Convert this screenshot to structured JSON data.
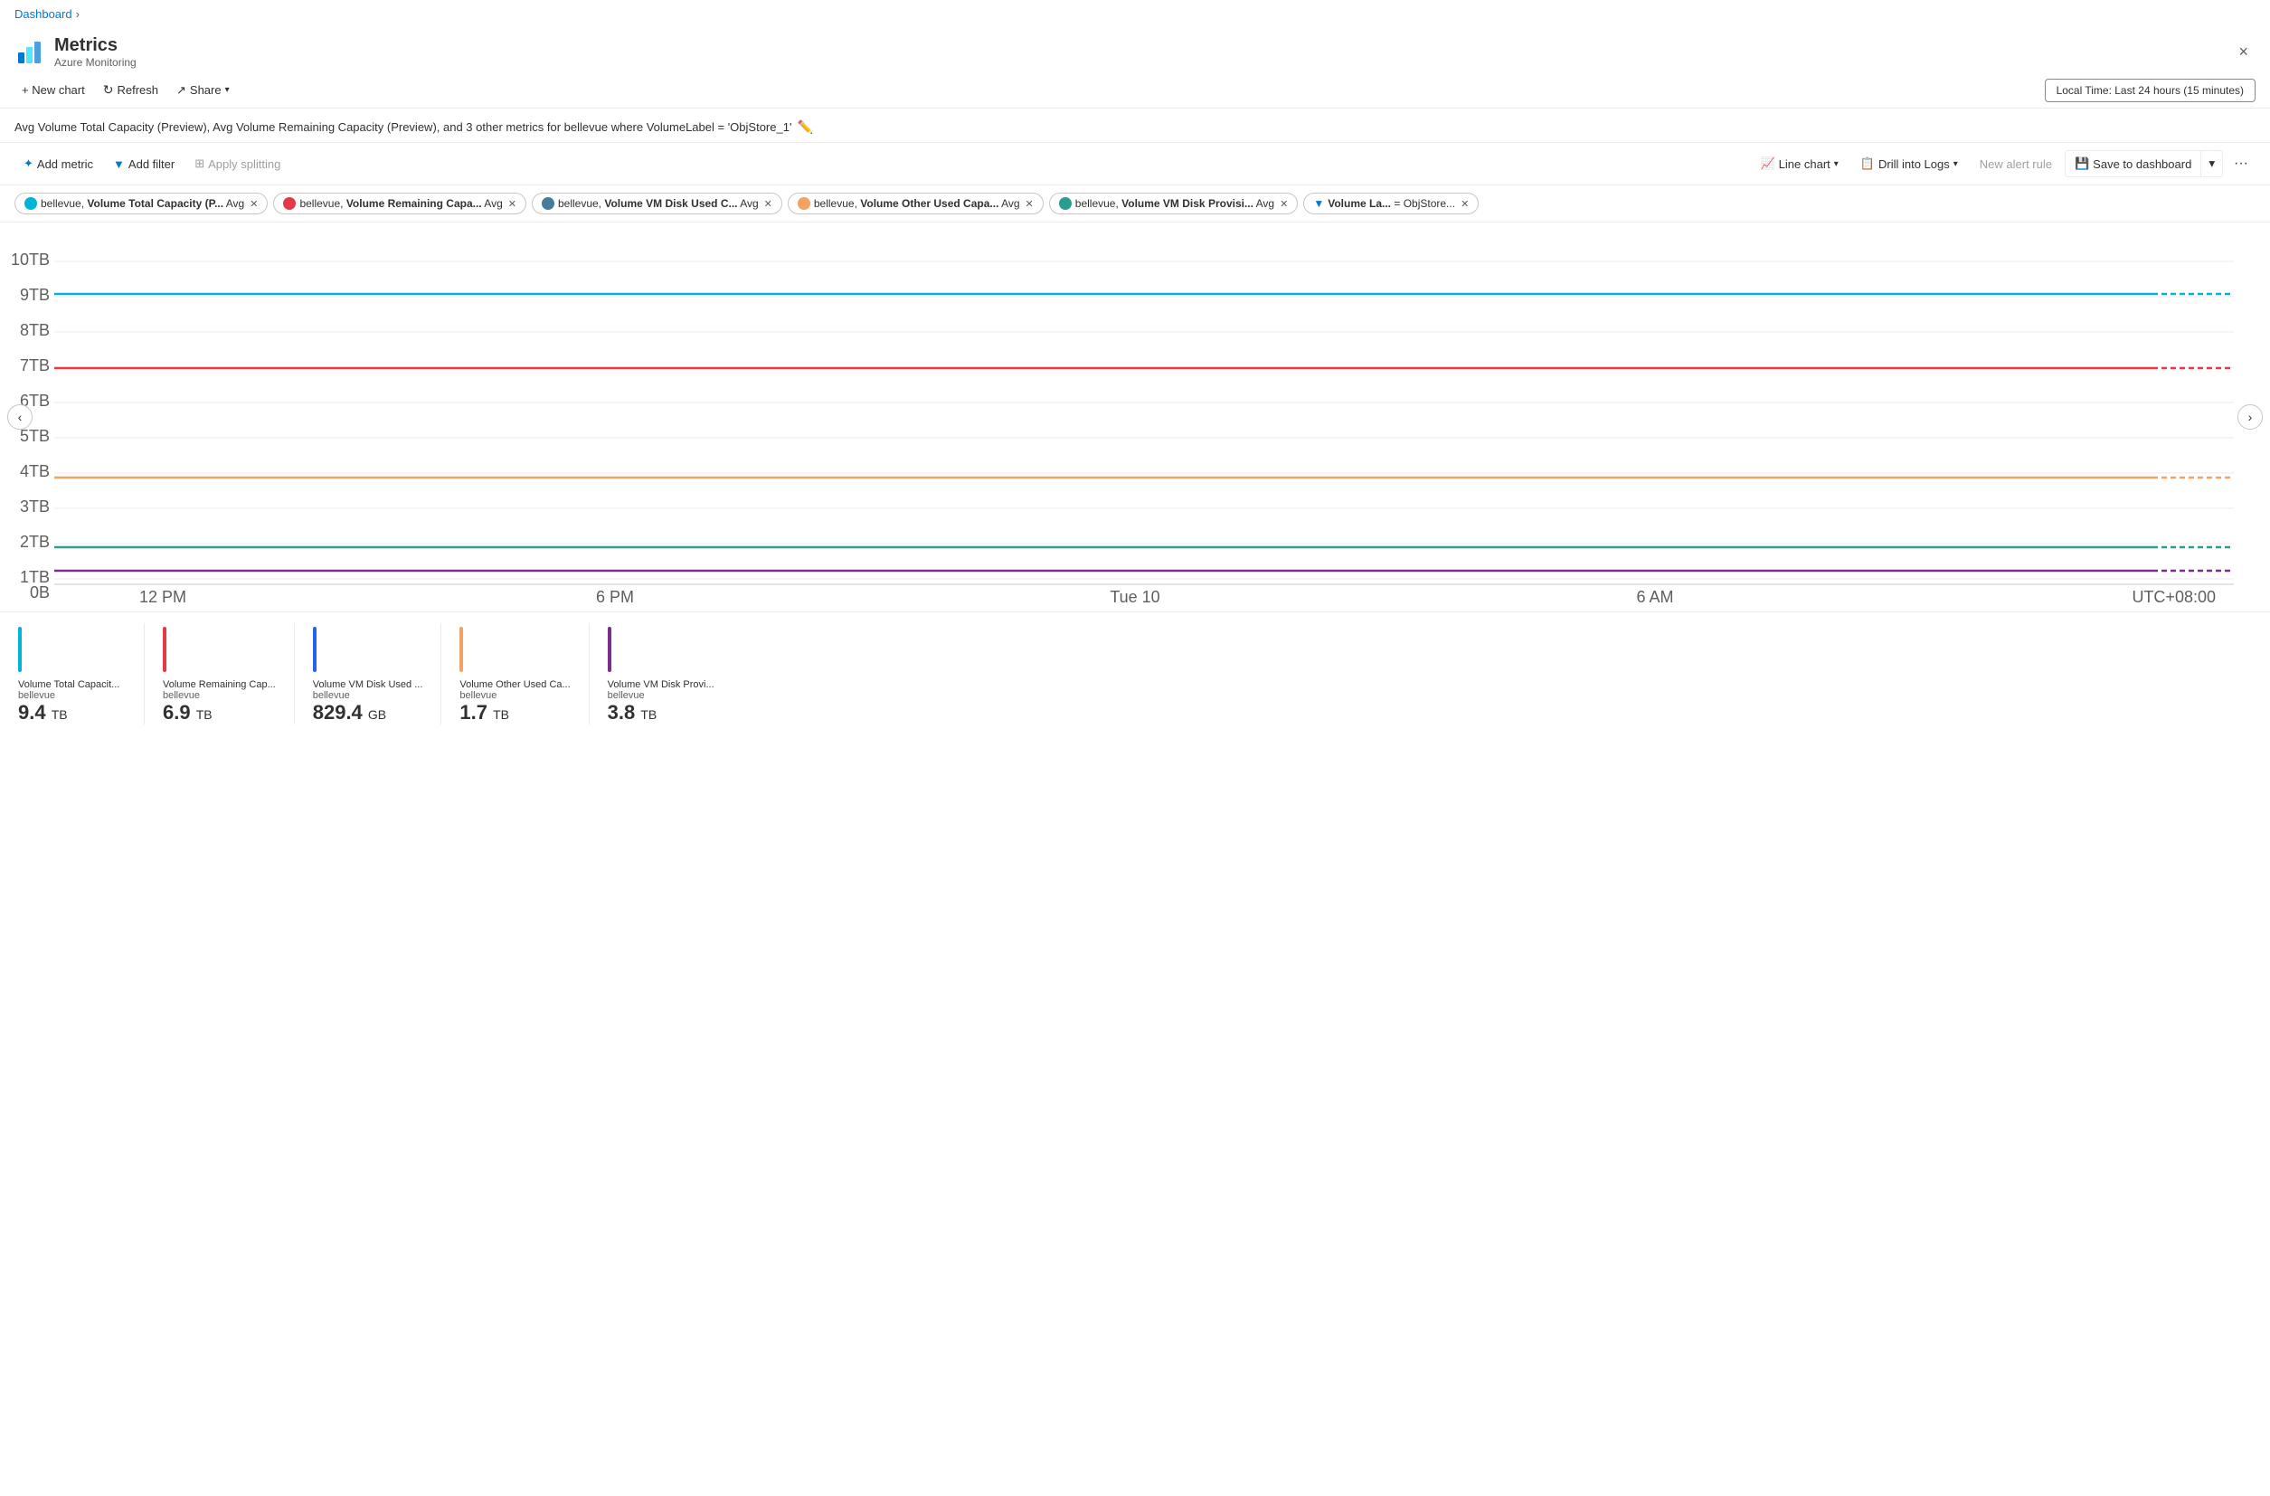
{
  "breadcrumb": {
    "label": "Dashboard",
    "chevron": "›"
  },
  "header": {
    "title": "Metrics",
    "subtitle": "Azure Monitoring",
    "close_label": "×"
  },
  "toolbar": {
    "new_chart": "+ New chart",
    "refresh": "Refresh",
    "share": "Share",
    "time_range": "Local Time: Last 24 hours (15 minutes)"
  },
  "chart_title": "Avg Volume Total Capacity (Preview), Avg Volume Remaining Capacity (Preview), and 3 other metrics for bellevue where VolumeLabel = 'ObjStore_1'",
  "metrics_toolbar": {
    "add_metric": "Add metric",
    "add_filter": "Add filter",
    "apply_splitting": "Apply splitting",
    "line_chart": "Line chart",
    "drill_into_logs": "Drill into Logs",
    "new_alert_rule": "New alert rule",
    "save_to_dashboard": "Save to dashboard"
  },
  "tags": [
    {
      "id": 1,
      "color": "#00b4d8",
      "text": "bellevue, ",
      "bold": "Volume Total Capacity (P...",
      "suffix": " Avg"
    },
    {
      "id": 2,
      "color": "#e63946",
      "text": "bellevue, ",
      "bold": "Volume Remaining Capa...",
      "suffix": " Avg"
    },
    {
      "id": 3,
      "color": "#457b9d",
      "text": "bellevue, ",
      "bold": "Volume VM Disk Used C...",
      "suffix": " Avg"
    },
    {
      "id": 4,
      "color": "#f4a261",
      "text": "bellevue, ",
      "bold": "Volume Other Used Capa...",
      "suffix": " Avg"
    },
    {
      "id": 5,
      "color": "#2a9d8f",
      "text": "bellevue, ",
      "bold": "Volume VM Disk Provisi...",
      "suffix": " Avg"
    }
  ],
  "filter_tag": {
    "label": "Volume La...",
    "operator": " = ",
    "value": "ObjStore..."
  },
  "chart": {
    "y_axis": [
      "10TB",
      "9TB",
      "8TB",
      "7TB",
      "6TB",
      "5TB",
      "4TB",
      "3TB",
      "2TB",
      "1TB",
      "0B"
    ],
    "x_axis": [
      "12 PM",
      "6 PM",
      "Tue 10",
      "6 AM",
      "UTC+08:00"
    ],
    "lines": [
      {
        "id": "total_capacity",
        "color": "#00b4d8",
        "y_pct": 88,
        "dashed_color": "#00b4d8"
      },
      {
        "id": "remaining_capacity",
        "color": "#e63946",
        "y_pct": 68,
        "dashed_color": "#e63946"
      },
      {
        "id": "other_used",
        "color": "#f4a261",
        "y_pct": 38,
        "dashed_color": "#f4a261"
      },
      {
        "id": "vm_disk_used",
        "color": "#2a9d8f",
        "y_pct": 16,
        "dashed_color": "#2a9d8f"
      },
      {
        "id": "vm_disk_prov",
        "color": "#7b2d8b",
        "y_pct": 8,
        "dashed_color": "#7b2d8b"
      }
    ]
  },
  "legend": [
    {
      "id": "total_capacity",
      "color": "#00b4d8",
      "title": "Volume Total Capacit...",
      "subtitle": "bellevue",
      "value": "9.4",
      "unit": "TB"
    },
    {
      "id": "remaining_capacity",
      "color": "#e63946",
      "title": "Volume Remaining Cap...",
      "subtitle": "bellevue",
      "value": "6.9",
      "unit": "TB"
    },
    {
      "id": "vm_disk_used",
      "color": "#2563eb",
      "title": "Volume VM Disk Used ...",
      "subtitle": "bellevue",
      "value": "829.4",
      "unit": "GB"
    },
    {
      "id": "other_used",
      "color": "#f4a261",
      "title": "Volume Other Used Ca...",
      "subtitle": "bellevue",
      "value": "1.7",
      "unit": "TB"
    },
    {
      "id": "vm_disk_prov",
      "color": "#7b2d8b",
      "title": "Volume VM Disk Provi...",
      "subtitle": "bellevue",
      "value": "3.8",
      "unit": "TB"
    }
  ]
}
